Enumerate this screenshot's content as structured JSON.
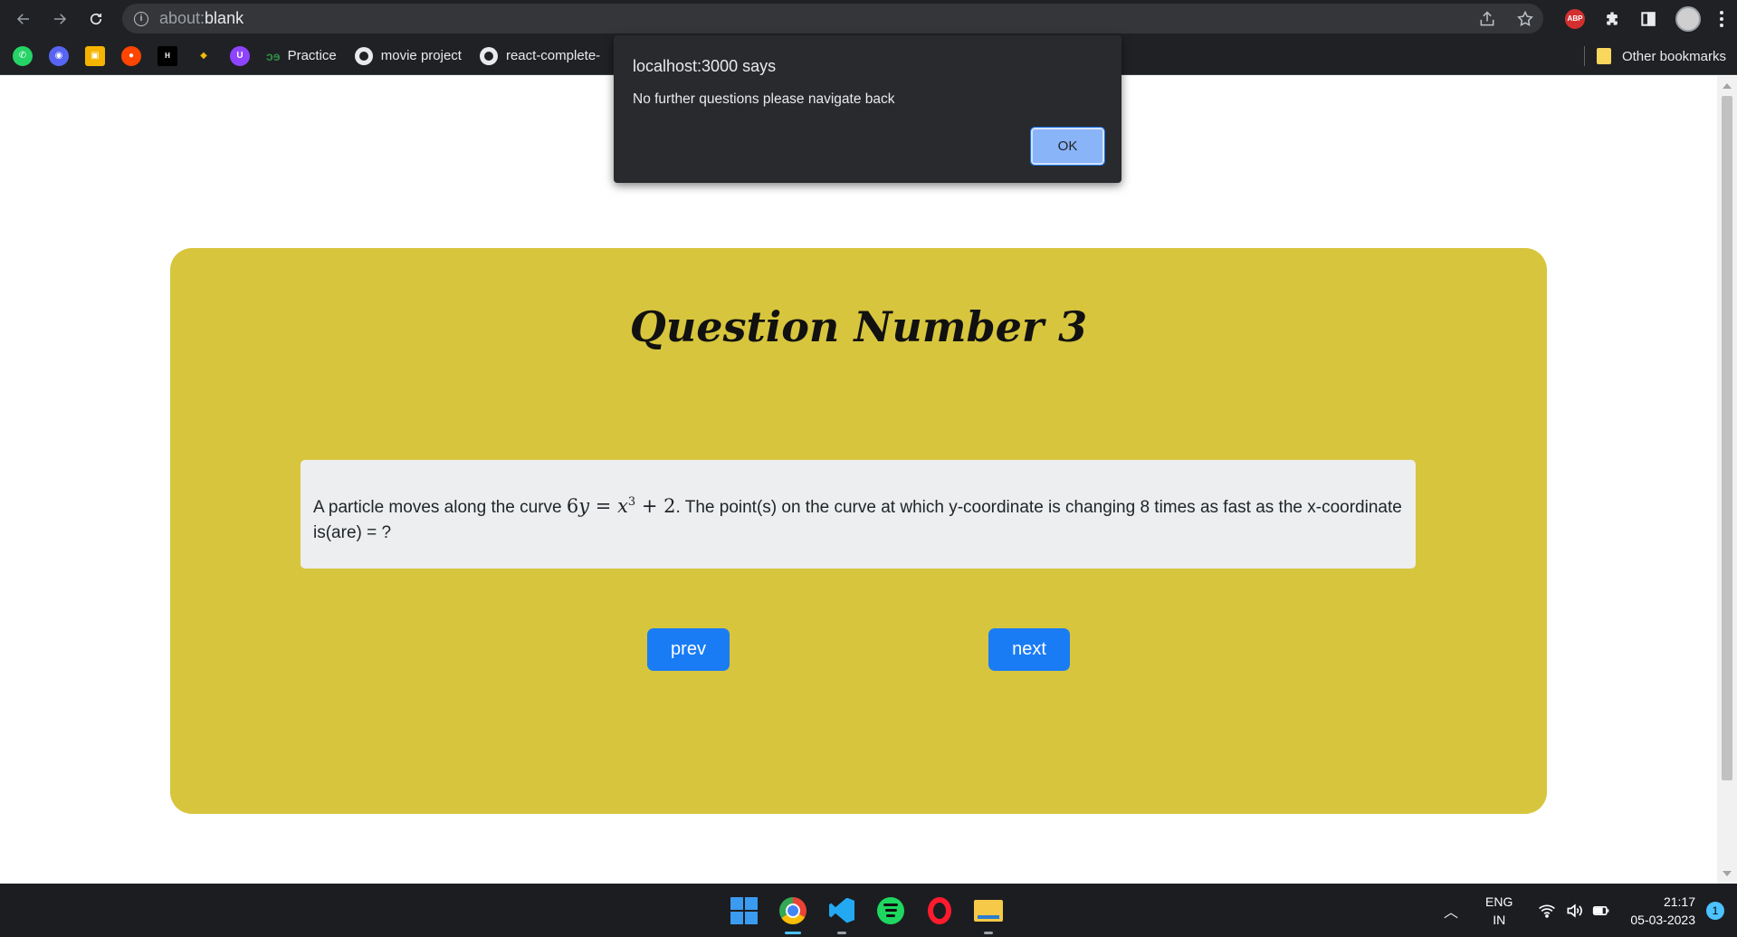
{
  "browser": {
    "url_prefix": "about:",
    "url_main": "blank",
    "bookmarks": [
      {
        "label": "Practice",
        "icon": "geeksforgeeks-icon"
      },
      {
        "label": "movie project",
        "icon": "github-icon"
      },
      {
        "label": "react-complete-",
        "icon": "github-icon"
      }
    ],
    "other_bookmarks": "Other bookmarks",
    "abp_label": "ABP",
    "gfg_glyph": "ɔɘ"
  },
  "page": {
    "title": "Question Number 3",
    "question_before": "A particle moves along the curve",
    "question_math": {
      "lhs": "6",
      "var_y": "y",
      "eq": " = ",
      "var_x": "x",
      "exp": "3",
      "rest": " + 2"
    },
    "question_after": ". The point(s) on the curve at which y-coordinate is changing 8 times as fast as the x-coordinate is(are) = ?",
    "prev_label": "prev",
    "next_label": "next",
    "colors": {
      "card": "#d7c53e",
      "button": "#1a7cf5"
    }
  },
  "dialog": {
    "title": "localhost:3000 says",
    "message": "No further questions please navigate back",
    "ok_label": "OK"
  },
  "taskbar": {
    "lang_line1": "ENG",
    "lang_line2": "IN",
    "time": "21:17",
    "date": "05-03-2023",
    "notifications": "1"
  }
}
